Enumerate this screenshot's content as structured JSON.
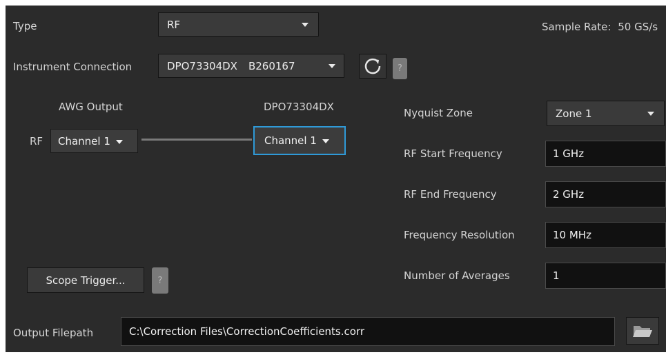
{
  "type": {
    "label": "Type",
    "value": "RF"
  },
  "sample_rate": {
    "label": "Sample Rate:",
    "value": "50 GS/s"
  },
  "instrument": {
    "label": "Instrument Connection",
    "model": "DPO73304DX",
    "serial": "B260167",
    "help": "?"
  },
  "routing": {
    "awg_header": "AWG Output",
    "scope_header": "DPO73304DX",
    "awg_row_label": "RF",
    "awg_channel": "Channel 1",
    "scope_channel": "Channel 1"
  },
  "settings": {
    "nyquist_zone": {
      "label": "Nyquist Zone",
      "value": "Zone 1"
    },
    "rf_start": {
      "label": "RF Start Frequency",
      "value": "1 GHz"
    },
    "rf_end": {
      "label": "RF End Frequency",
      "value": "2 GHz"
    },
    "freq_res": {
      "label": "Frequency Resolution",
      "value": "10 MHz"
    },
    "averages": {
      "label": "Number of Averages",
      "value": "1"
    }
  },
  "scope_trigger": {
    "label": "Scope Trigger...",
    "help": "?"
  },
  "output": {
    "label": "Output Filepath",
    "value": "C:\\Correction Files\\CorrectionCoefficients.corr"
  },
  "colors": {
    "panel_bg": "#2b2b2b",
    "field_bg": "#111111",
    "accent_focus": "#2f9ad8",
    "help_bg": "#7a7a7a"
  },
  "icons": [
    "refresh-icon",
    "folder-open-icon",
    "chevron-down-icon"
  ]
}
